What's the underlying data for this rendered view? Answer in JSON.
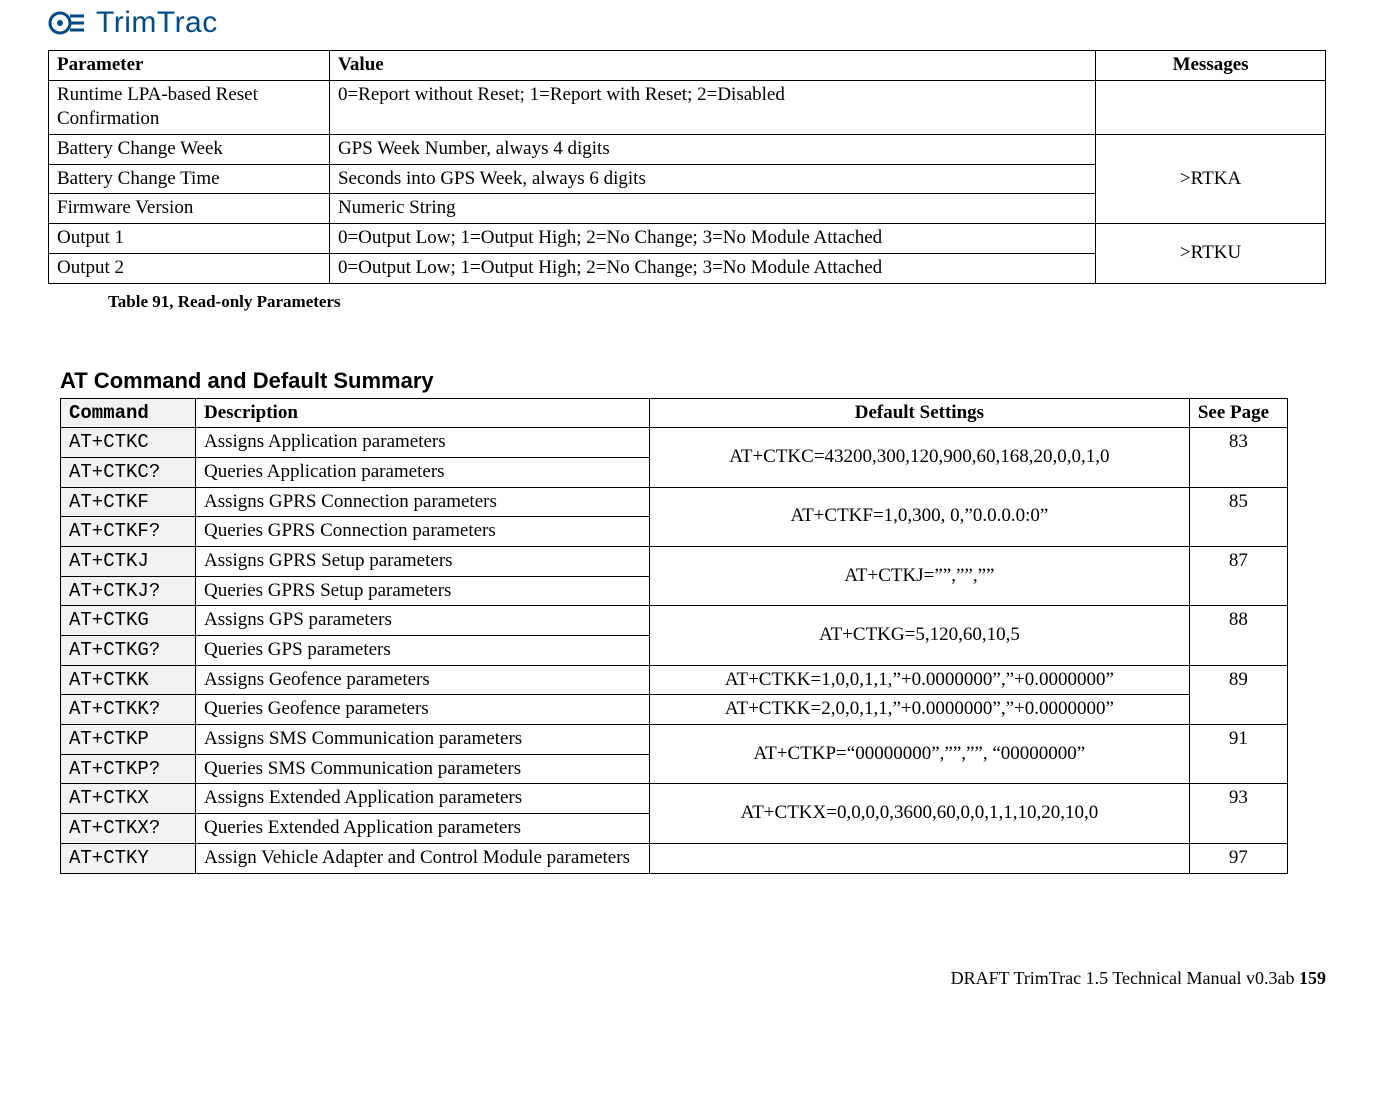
{
  "brand": "TrimTrac",
  "table1": {
    "headers": {
      "param": "Parameter",
      "value": "Value",
      "messages": "Messages"
    },
    "rows": [
      {
        "param": "Runtime LPA-based Reset Confirmation",
        "value": "0=Report without Reset; 1=Report with Reset; 2=Disabled",
        "msg": ""
      },
      {
        "param": "Battery Change Week",
        "value": "GPS Week Number, always 4 digits"
      },
      {
        "param": "Battery Change Time",
        "value": "Seconds into GPS Week, always 6 digits"
      },
      {
        "param": "Firmware Version",
        "value": "Numeric String"
      },
      {
        "param": "Output 1",
        "value": "0=Output Low; 1=Output High; 2=No Change; 3=No Module Attached"
      },
      {
        "param": "Output 2",
        "value": "0=Output Low; 1=Output High; 2=No Change; 3=No Module Attached"
      }
    ],
    "msg_rtka": ">RTKA",
    "msg_rtku": ">RTKU",
    "caption": "Table 91, Read-only Parameters"
  },
  "section2_title": "AT Command and Default Summary",
  "table2": {
    "headers": {
      "cmd": "Command",
      "desc": "Description",
      "def": "Default Settings",
      "page": "See Page"
    },
    "groups": [
      {
        "a": {
          "cmd": "AT+CTKC",
          "desc": "Assigns Application parameters"
        },
        "b": {
          "cmd": "AT+CTKC?",
          "desc": "Queries Application parameters"
        },
        "def": "AT+CTKC=43200,300,120,900,60,168,20,0,0,1,0",
        "page": "83"
      },
      {
        "a": {
          "cmd": "AT+CTKF",
          "desc": "Assigns GPRS Connection parameters"
        },
        "b": {
          "cmd": "AT+CTKF?",
          "desc": "Queries GPRS Connection parameters"
        },
        "def": "AT+CTKF=1,0,300, 0,”0.0.0.0:0”",
        "page": "85"
      },
      {
        "a": {
          "cmd": "AT+CTKJ",
          "desc": "Assigns GPRS Setup parameters"
        },
        "b": {
          "cmd": "AT+CTKJ?",
          "desc": "Queries GPRS Setup parameters"
        },
        "def": "AT+CTKJ=””,””,””",
        "page": "87"
      },
      {
        "a": {
          "cmd": "AT+CTKG",
          "desc": "Assigns GPS parameters"
        },
        "b": {
          "cmd": "AT+CTKG?",
          "desc": "Queries GPS parameters"
        },
        "def": "AT+CTKG=5,120,60,10,5",
        "page": "88"
      },
      {
        "a": {
          "cmd": "AT+CTKK",
          "desc": "Assigns Geofence parameters"
        },
        "b": {
          "cmd": "AT+CTKK?",
          "desc": "Queries Geofence parameters"
        },
        "def_lines": [
          "AT+CTKK=1,0,0,1,1,”+0.0000000”,”+0.0000000”",
          "AT+CTKK=2,0,0,1,1,”+0.0000000”,”+0.0000000”"
        ],
        "page": "89"
      },
      {
        "a": {
          "cmd": "AT+CTKP",
          "desc": "Assigns SMS Communication parameters"
        },
        "b": {
          "cmd": "AT+CTKP?",
          "desc": "Queries SMS Communication parameters"
        },
        "def": "AT+CTKP=“00000000”,””,””, “00000000”",
        "page": "91"
      },
      {
        "a": {
          "cmd": "AT+CTKX",
          "desc": "Assigns Extended Application parameters"
        },
        "b": {
          "cmd": "AT+CTKX?",
          "desc": "Queries Extended Application parameters"
        },
        "def": "AT+CTKX=0,0,0,0,3600,60,0,0,1,1,10,20,10,0",
        "page": "93"
      }
    ],
    "tail": {
      "cmd": "AT+CTKY",
      "desc": "Assign Vehicle Adapter and Control Module parameters",
      "def": "",
      "page": "97"
    }
  },
  "footer": {
    "text": "DRAFT TrimTrac 1.5 Technical Manual v0.3ab ",
    "page": "159"
  }
}
